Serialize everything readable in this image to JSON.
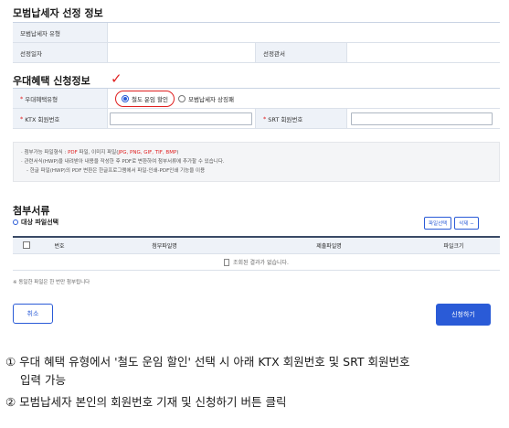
{
  "section1": {
    "title": "모범납세자 선정 정보",
    "type_label": "모범납세자 유형",
    "date_label": "선정일자",
    "office_label": "선정관서"
  },
  "section2": {
    "title": "우대혜택 신청정보",
    "benefit_label": "우대혜택유형",
    "radio1_label": "철도 운임 할인",
    "radio2_label": "모범납세자 상징패",
    "ktx_label": "KTX 회원번호",
    "srt_label": "SRT 회원번호",
    "annotation_mark": "✓",
    "colors": {
      "annotation": "#e02020",
      "accent": "#2a5bd7"
    }
  },
  "notes": {
    "line1_prefix": "· 첨부가능 파일형식 : ",
    "line1_pdf": "PDF",
    "line1_mid": " 파일, 이미지 파일(",
    "line1_img": "JPG, PNG, GIF, TIF, BMP",
    "line1_suffix": ")",
    "line2": "· 관련서식(HWP)을 내려받아 내용을 작성한 후 PDF로 변환하여 첨부서류에 추가할 수 있습니다.",
    "line3": "- 한글 파일(HWP)의 PDF 변환은 한글프로그램에서 파일-인쇄-PDF인쇄 기능을 이용"
  },
  "attachments": {
    "title": "첨부서류",
    "subtitle": "대상 파일선택",
    "select_btn": "파일선택",
    "delete_btn": "삭제",
    "col_no": "번호",
    "col_attach": "첨부파일명",
    "col_submit": "제출파일명",
    "col_size": "파일크기",
    "empty": "조회된 결과가 없습니다.",
    "footnote": "※ 동일한 파일은 한 번만 첨부됩니다"
  },
  "buttons": {
    "cancel": "취소",
    "apply": "신청하기"
  },
  "description": {
    "line1": "① 우대 혜택 유형에서 '철도 운임 할인' 선택 시 아래 KTX 회원번호 및 SRT 회원번호",
    "line2": "입력 가능",
    "line3": "② 모범납세자 본인의 회원번호 기재 및 신청하기 버튼 클릭"
  }
}
